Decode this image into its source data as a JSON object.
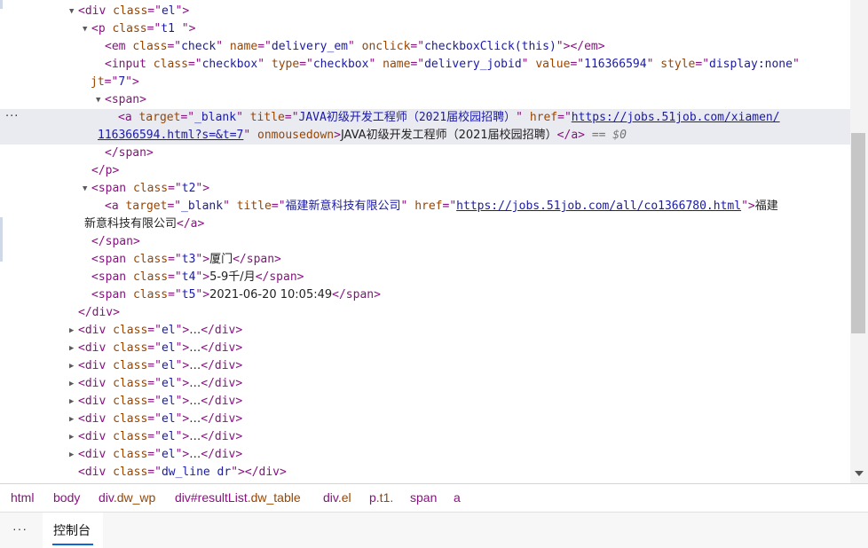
{
  "dom_tree": {
    "lines": [
      {
        "indent": 0,
        "toggle": "▼",
        "html": "<span class=\"tag\">&lt;div </span><span class=\"an\">class</span><span class=\"tag\">=\"</span><span class=\"av\">el</span><span class=\"tag\">\"&gt;</span>"
      },
      {
        "indent": 1,
        "toggle": "▼",
        "html": "<span class=\"tag\">&lt;p </span><span class=\"an\">class</span><span class=\"tag\">=\"</span><span class=\"av\">t1 </span><span class=\"tag\">\"&gt;</span>"
      },
      {
        "indent": 2,
        "toggle": "",
        "html": "<span class=\"tag\">&lt;em </span><span class=\"an\">class</span><span class=\"tag\">=\"</span><span class=\"av\">check</span><span class=\"tag\">\" </span><span class=\"an\">name</span><span class=\"tag\">=\"</span><span class=\"av\">delivery_em</span><span class=\"tag\">\" </span><span class=\"an\">onclick</span><span class=\"tag\">=\"</span><span class=\"av\">checkboxClick(this)</span><span class=\"tag\">\"&gt;&lt;/em&gt;</span>"
      },
      {
        "indent": 2,
        "toggle": "",
        "html": "<span class=\"tag\">&lt;input </span><span class=\"an\">class</span><span class=\"tag\">=\"</span><span class=\"av\">checkbox</span><span class=\"tag\">\" </span><span class=\"an\">type</span><span class=\"tag\">=\"</span><span class=\"av\">checkbox</span><span class=\"tag\">\" </span><span class=\"an\">name</span><span class=\"tag\">=\"</span><span class=\"av\">delivery_jobid</span><span class=\"tag\">\" </span><span class=\"an\">value</span><span class=\"tag\">=\"</span><span class=\"av\">116366594</span><span class=\"tag\">\" </span><span class=\"an\">style</span><span class=\"tag\">=\"</span><span class=\"av\">display:none</span><span class=\"tag\">\"</span>"
      },
      {
        "indent": 2,
        "toggle": "",
        "html": "<span class=\"an\">jt</span><span class=\"tag\">=\"</span><span class=\"av\">7</span><span class=\"tag\">\"&gt;</span>",
        "hang": true
      },
      {
        "indent": 2,
        "toggle": "▼",
        "html": "<span class=\"tag\">&lt;span&gt;</span>"
      },
      {
        "indent": 3,
        "toggle": "",
        "hl": true,
        "html": "<span class=\"tag\">&lt;a </span><span class=\"an\">target</span><span class=\"tag\">=\"</span><span class=\"av\">_blank</span><span class=\"tag\">\" </span><span class=\"an\">title</span><span class=\"tag\">=\"</span><span class=\"av\">JAVA初级开发工程师（2021届校园招聘）</span><span class=\"tag\">\" </span><span class=\"an\">href</span><span class=\"tag\">=\"</span><span class=\"link\">https://jobs.51job.com/xiamen/</span>"
      },
      {
        "indent": 3,
        "toggle": "",
        "hl": true,
        "html": "<span class=\"link\">116366594.html?s=&amp;t=7</span><span class=\"tag\">\" </span><span class=\"an\">onmousedown</span><span class=\"tag\">&gt;</span><span class=\"tx\">JAVA初级开发工程师（2021届校园招聘）</span><span class=\"tag\">&lt;/a&gt;</span> <span class=\"eq\">== $0</span>",
        "hang": true
      },
      {
        "indent": 2,
        "toggle": "",
        "html": "<span class=\"tag\">&lt;/span&gt;</span>"
      },
      {
        "indent": 1,
        "toggle": "",
        "html": "<span class=\"tag\">&lt;/p&gt;</span>"
      },
      {
        "indent": 1,
        "toggle": "▼",
        "html": "<span class=\"tag\">&lt;span </span><span class=\"an\">class</span><span class=\"tag\">=\"</span><span class=\"av\">t2</span><span class=\"tag\">\"&gt;</span>"
      },
      {
        "indent": 2,
        "toggle": "",
        "html": "<span class=\"tag\">&lt;a </span><span class=\"an\">target</span><span class=\"tag\">=\"</span><span class=\"av\">_blank</span><span class=\"tag\">\" </span><span class=\"an\">title</span><span class=\"tag\">=\"</span><span class=\"av\">福建新意科技有限公司</span><span class=\"tag\">\" </span><span class=\"an\">href</span><span class=\"tag\">=\"</span><span class=\"link\">https://jobs.51job.com/all/co1366780.html</span><span class=\"tag\">\"&gt;</span><span class=\"tx\">福建</span>"
      },
      {
        "indent": 2,
        "toggle": "",
        "html": "<span class=\"tx\">新意科技有限公司</span><span class=\"tag\">&lt;/a&gt;</span>"
      },
      {
        "indent": 1,
        "toggle": "",
        "html": "<span class=\"tag\">&lt;/span&gt;</span>"
      },
      {
        "indent": 1,
        "toggle": "",
        "html": "<span class=\"tag\">&lt;span </span><span class=\"an\">class</span><span class=\"tag\">=\"</span><span class=\"av\">t3</span><span class=\"tag\">\"&gt;</span><span class=\"tx\">厦门</span><span class=\"tag\">&lt;/span&gt;</span>"
      },
      {
        "indent": 1,
        "toggle": "",
        "html": "<span class=\"tag\">&lt;span </span><span class=\"an\">class</span><span class=\"tag\">=\"</span><span class=\"av\">t4</span><span class=\"tag\">\"&gt;</span><span class=\"tx\">5-9千/月</span><span class=\"tag\">&lt;/span&gt;</span>"
      },
      {
        "indent": 1,
        "toggle": "",
        "html": "<span class=\"tag\">&lt;span </span><span class=\"an\">class</span><span class=\"tag\">=\"</span><span class=\"av\">t5</span><span class=\"tag\">\"&gt;</span><span class=\"tx\">2021-06-20 10:05:49</span><span class=\"tag\">&lt;/span&gt;</span>"
      },
      {
        "indent": 0,
        "toggle": "",
        "html": "<span class=\"tag\">&lt;/div&gt;</span>"
      },
      {
        "indent": 0,
        "toggle": "▶",
        "html": "<span class=\"tag\">&lt;div </span><span class=\"an\">class</span><span class=\"tag\">=\"</span><span class=\"av\">el</span><span class=\"tag\">\"&gt;</span><span class=\"tx\">…</span><span class=\"tag\">&lt;/div&gt;</span>"
      },
      {
        "indent": 0,
        "toggle": "▶",
        "html": "<span class=\"tag\">&lt;div </span><span class=\"an\">class</span><span class=\"tag\">=\"</span><span class=\"av\">el</span><span class=\"tag\">\"&gt;</span><span class=\"tx\">…</span><span class=\"tag\">&lt;/div&gt;</span>"
      },
      {
        "indent": 0,
        "toggle": "▶",
        "html": "<span class=\"tag\">&lt;div </span><span class=\"an\">class</span><span class=\"tag\">=\"</span><span class=\"av\">el</span><span class=\"tag\">\"&gt;</span><span class=\"tx\">…</span><span class=\"tag\">&lt;/div&gt;</span>"
      },
      {
        "indent": 0,
        "toggle": "▶",
        "html": "<span class=\"tag\">&lt;div </span><span class=\"an\">class</span><span class=\"tag\">=\"</span><span class=\"av\">el</span><span class=\"tag\">\"&gt;</span><span class=\"tx\">…</span><span class=\"tag\">&lt;/div&gt;</span>"
      },
      {
        "indent": 0,
        "toggle": "▶",
        "html": "<span class=\"tag\">&lt;div </span><span class=\"an\">class</span><span class=\"tag\">=\"</span><span class=\"av\">el</span><span class=\"tag\">\"&gt;</span><span class=\"tx\">…</span><span class=\"tag\">&lt;/div&gt;</span>"
      },
      {
        "indent": 0,
        "toggle": "▶",
        "html": "<span class=\"tag\">&lt;div </span><span class=\"an\">class</span><span class=\"tag\">=\"</span><span class=\"av\">el</span><span class=\"tag\">\"&gt;</span><span class=\"tx\">…</span><span class=\"tag\">&lt;/div&gt;</span>"
      },
      {
        "indent": 0,
        "toggle": "▶",
        "html": "<span class=\"tag\">&lt;div </span><span class=\"an\">class</span><span class=\"tag\">=\"</span><span class=\"av\">el</span><span class=\"tag\">\"&gt;</span><span class=\"tx\">…</span><span class=\"tag\">&lt;/div&gt;</span>"
      },
      {
        "indent": 0,
        "toggle": "▶",
        "html": "<span class=\"tag\">&lt;div </span><span class=\"an\">class</span><span class=\"tag\">=\"</span><span class=\"av\">el</span><span class=\"tag\">\"&gt;</span><span class=\"tx\">…</span><span class=\"tag\">&lt;/div&gt;</span>"
      },
      {
        "indent": 0,
        "toggle": "",
        "html": "<span class=\"tag\">&lt;div </span><span class=\"an\">class</span><span class=\"tag\">=\"</span><span class=\"av\">dw_line dr</span><span class=\"tag\">\"&gt;&lt;/div&gt;</span>"
      }
    ],
    "selected_dots": "···"
  },
  "breadcrumbs": [
    {
      "tag": "html",
      "cls": ""
    },
    {
      "tag": "body",
      "cls": ""
    },
    {
      "tag": "div",
      "cls": ".dw_wp"
    },
    {
      "tag": "div#resultList",
      "cls": ".dw_table"
    },
    {
      "tag": "div",
      "cls": ".el"
    },
    {
      "tag": "p",
      "cls": ".t1."
    },
    {
      "tag": "span",
      "cls": ""
    },
    {
      "tag": "a",
      "cls": ""
    }
  ],
  "drawer": {
    "more_label": "···",
    "tab_label": "控制台"
  },
  "colors": {
    "tag": "#881280",
    "attr_name": "#994500",
    "attr_value": "#1a1aa6",
    "selected_bg": "#eaeaf1",
    "tab_underline": "#0b68d6"
  }
}
